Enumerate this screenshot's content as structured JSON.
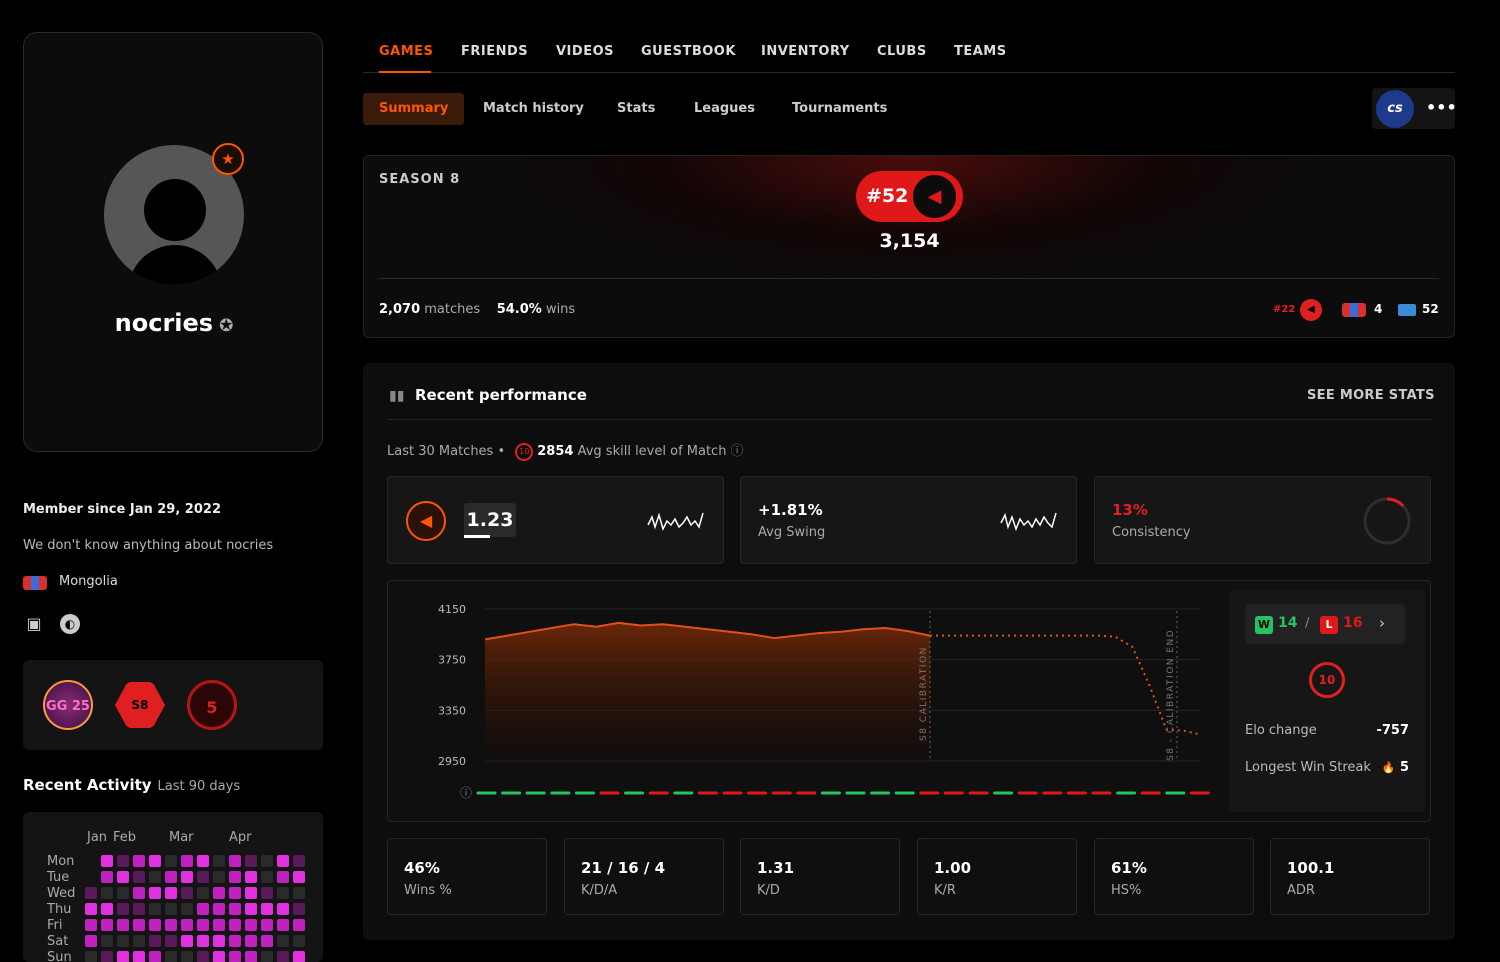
{
  "profile": {
    "username": "nocries",
    "member_since": "Member since Jan 29, 2022",
    "about": "We don't know anything about nocries",
    "country": "Mongolia",
    "badges": [
      "GG 25",
      "S8",
      "5"
    ]
  },
  "recent_activity": {
    "title": "Recent Activity",
    "subtitle": "Last 90 days",
    "months": [
      "Jan",
      "Feb",
      "Mar",
      "Apr"
    ],
    "days": [
      "Mon",
      "Tue",
      "Wed",
      "Thu",
      "Fri",
      "Sat",
      "Sun"
    ]
  },
  "top_nav": [
    "GAMES",
    "FRIENDS",
    "VIDEOS",
    "GUESTBOOK",
    "INVENTORY",
    "CLUBS",
    "TEAMS"
  ],
  "sub_nav": [
    "Summary",
    "Match history",
    "Stats",
    "Leagues",
    "Tournaments"
  ],
  "game_logo": "cs",
  "season": {
    "title": "SEASON 8",
    "rank": "#52",
    "elo": "3,154",
    "matches": "2,070",
    "matches_label": "matches",
    "win_rate": "54.0%",
    "win_label": "wins",
    "league_rank": "#22",
    "country_rank": "4",
    "region_rank": "52"
  },
  "performance": {
    "title": "Recent performance",
    "see_more": "SEE MORE STATS",
    "last_matches": "Last 30 Matches",
    "avg_skill": "2854",
    "avg_skill_label": "Avg skill level of Match",
    "kd": "1.23",
    "avg_swing": "+1.81%",
    "avg_swing_label": "Avg Swing",
    "consistency": "13%",
    "consistency_label": "Consistency",
    "wins": "14",
    "losses": "16",
    "wl_sep": "/",
    "level": "10",
    "elo_change_label": "Elo change",
    "elo_change": "-757",
    "win_streak_label": "Longest Win Streak",
    "win_streak": "5",
    "stats": [
      {
        "value": "46%",
        "label": "Wins %"
      },
      {
        "value": "21 / 16 / 4",
        "label": "K/D/A"
      },
      {
        "value": "1.31",
        "label": "K/D"
      },
      {
        "value": "1.00",
        "label": "K/R"
      },
      {
        "value": "61%",
        "label": "HS%"
      },
      {
        "value": "100.1",
        "label": "ADR"
      }
    ]
  },
  "chart_data": {
    "type": "area",
    "y_ticks": [
      "4150",
      "3750",
      "3350",
      "2950"
    ],
    "ylim": [
      2950,
      4150
    ],
    "annotations": [
      "S8 CALIBRATION",
      "S8 - CALIBRATION END"
    ],
    "series": [
      {
        "values": [
          3910,
          3940,
          3970,
          4000,
          4030,
          4010,
          4040,
          4020,
          4030,
          4010,
          3990,
          3970,
          3950,
          3920,
          3940,
          3960,
          3970,
          3990,
          4000,
          3975,
          3940
        ]
      }
    ],
    "projection": [
      3940,
      3940,
      3940,
      3940,
      3940,
      3940,
      3940,
      3940,
      3940,
      3940,
      3940,
      3930,
      3850,
      3550,
      3200,
      3190,
      3160
    ],
    "results": [
      "W",
      "W",
      "W",
      "W",
      "W",
      "L",
      "W",
      "L",
      "W",
      "L",
      "L",
      "L",
      "L",
      "L",
      "W",
      "W",
      "W",
      "W",
      "L",
      "L",
      "L",
      "W",
      "L",
      "L",
      "L",
      "L",
      "W",
      "L",
      "W",
      "L"
    ]
  },
  "colors": {
    "accent": "#ff5500",
    "red": "#e01818",
    "win": "#22c55e",
    "loss": "#e01818"
  }
}
